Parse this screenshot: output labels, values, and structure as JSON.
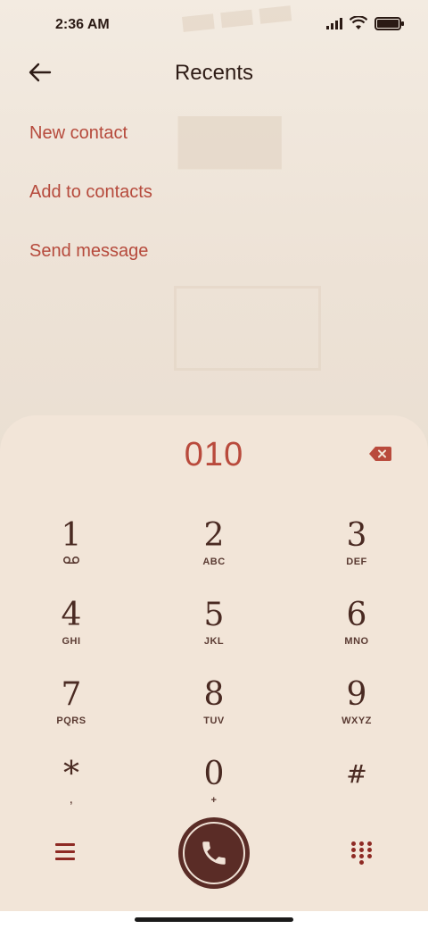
{
  "status": {
    "time": "2:36 AM",
    "battery_level": 1.0
  },
  "header": {
    "title": "Recents",
    "back_icon": "back-arrow-icon"
  },
  "actions": [
    {
      "label": "New contact"
    },
    {
      "label": "Add to contacts"
    },
    {
      "label": "Send message"
    }
  ],
  "dialer": {
    "number": "010",
    "backspace_icon": "backspace-icon",
    "keys": [
      {
        "digit": "1",
        "letters": ""
      },
      {
        "digit": "2",
        "letters": "ABC"
      },
      {
        "digit": "3",
        "letters": "DEF"
      },
      {
        "digit": "4",
        "letters": "GHI"
      },
      {
        "digit": "5",
        "letters": "JKL"
      },
      {
        "digit": "6",
        "letters": "MNO"
      },
      {
        "digit": "7",
        "letters": "PQRS"
      },
      {
        "digit": "8",
        "letters": "TUV"
      },
      {
        "digit": "9",
        "letters": "WXYZ"
      },
      {
        "digit": "*",
        "letters": ","
      },
      {
        "digit": "0",
        "letters": "+"
      },
      {
        "digit": "#",
        "letters": ""
      }
    ]
  },
  "bottom": {
    "menu_icon": "menu-icon",
    "call_icon": "phone-icon",
    "keypad_icon": "dialpad-icon"
  },
  "colors": {
    "accent": "#b64a3c",
    "key_text": "#4a2a22",
    "call_button": "#5a2c26",
    "sheet": "#f2e5d8"
  }
}
